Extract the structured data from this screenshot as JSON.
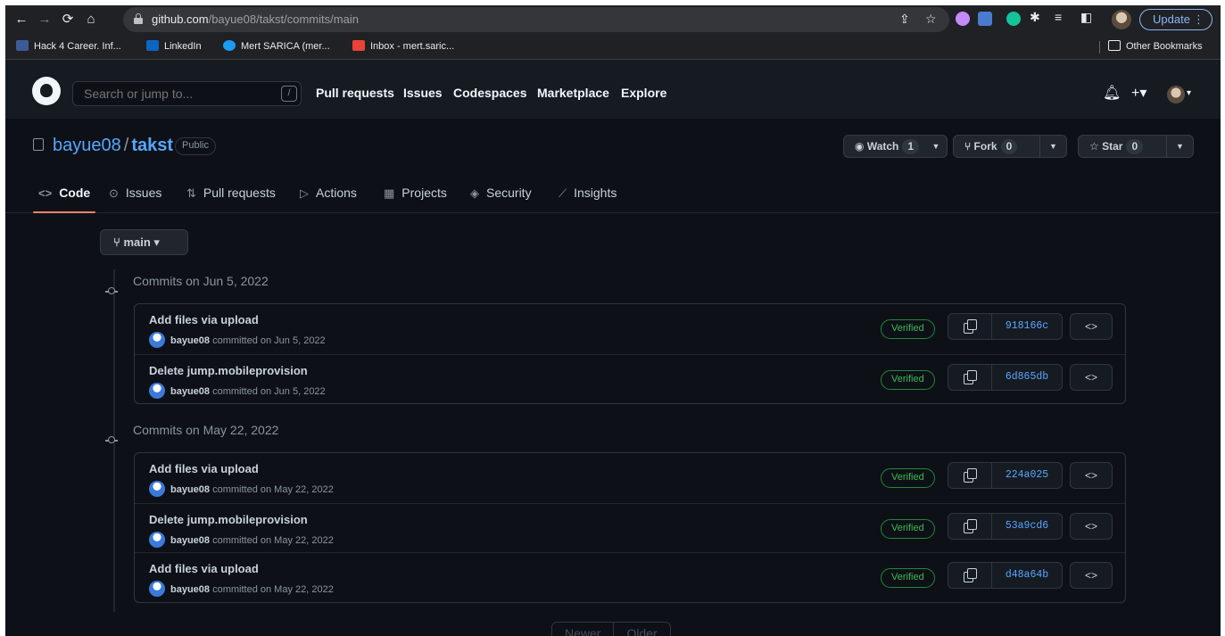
{
  "browser": {
    "url_host": "github.com",
    "url_path": "/bayue08/takst/commits/main",
    "update_label": "Update",
    "update_menu": "⋮",
    "bookmarks": [
      "Hack 4 Career. Inf...",
      "LinkedIn",
      "Mert SARICA (mer...",
      "Inbox - mert.saric..."
    ],
    "other_bookmarks": "Other Bookmarks"
  },
  "github": {
    "search_placeholder": "Search or jump to...",
    "search_shortcut": "/",
    "nav": [
      "Pull requests",
      "Issues",
      "Codespaces",
      "Marketplace",
      "Explore"
    ]
  },
  "repo": {
    "owner": "bayue08",
    "separator": "/",
    "name": "takst",
    "visibility": "Public",
    "watch": {
      "label": "Watch",
      "count": "1"
    },
    "fork": {
      "label": "Fork",
      "count": "0"
    },
    "star": {
      "label": "Star",
      "count": "0"
    },
    "tabs": [
      "Code",
      "Issues",
      "Pull requests",
      "Actions",
      "Projects",
      "Security",
      "Insights"
    ]
  },
  "branch": "main",
  "commit_groups": [
    {
      "heading": "Commits on Jun 5, 2022",
      "commits": [
        {
          "title": "Add files via upload",
          "author": "bayue08",
          "meta": "committed on Jun 5, 2022",
          "status": "Verified",
          "sha": "918166c"
        },
        {
          "title": "Delete jump.mobileprovision",
          "author": "bayue08",
          "meta": "committed on Jun 5, 2022",
          "status": "Verified",
          "sha": "6d865db"
        }
      ]
    },
    {
      "heading": "Commits on May 22, 2022",
      "commits": [
        {
          "title": "Add files via upload",
          "author": "bayue08",
          "meta": "committed on May 22, 2022",
          "status": "Verified",
          "sha": "224a025"
        },
        {
          "title": "Delete jump.mobileprovision",
          "author": "bayue08",
          "meta": "committed on May 22, 2022",
          "status": "Verified",
          "sha": "53a9cd6"
        },
        {
          "title": "Add files via upload",
          "author": "bayue08",
          "meta": "committed on May 22, 2022",
          "status": "Verified",
          "sha": "d48a64b"
        }
      ]
    }
  ],
  "pagination": {
    "newer": "Newer",
    "older": "Older"
  },
  "colors": {
    "accent": "#58a6ff",
    "verified": "#3fb950",
    "tab_underline": "#f78166",
    "background": "#0d1117"
  }
}
